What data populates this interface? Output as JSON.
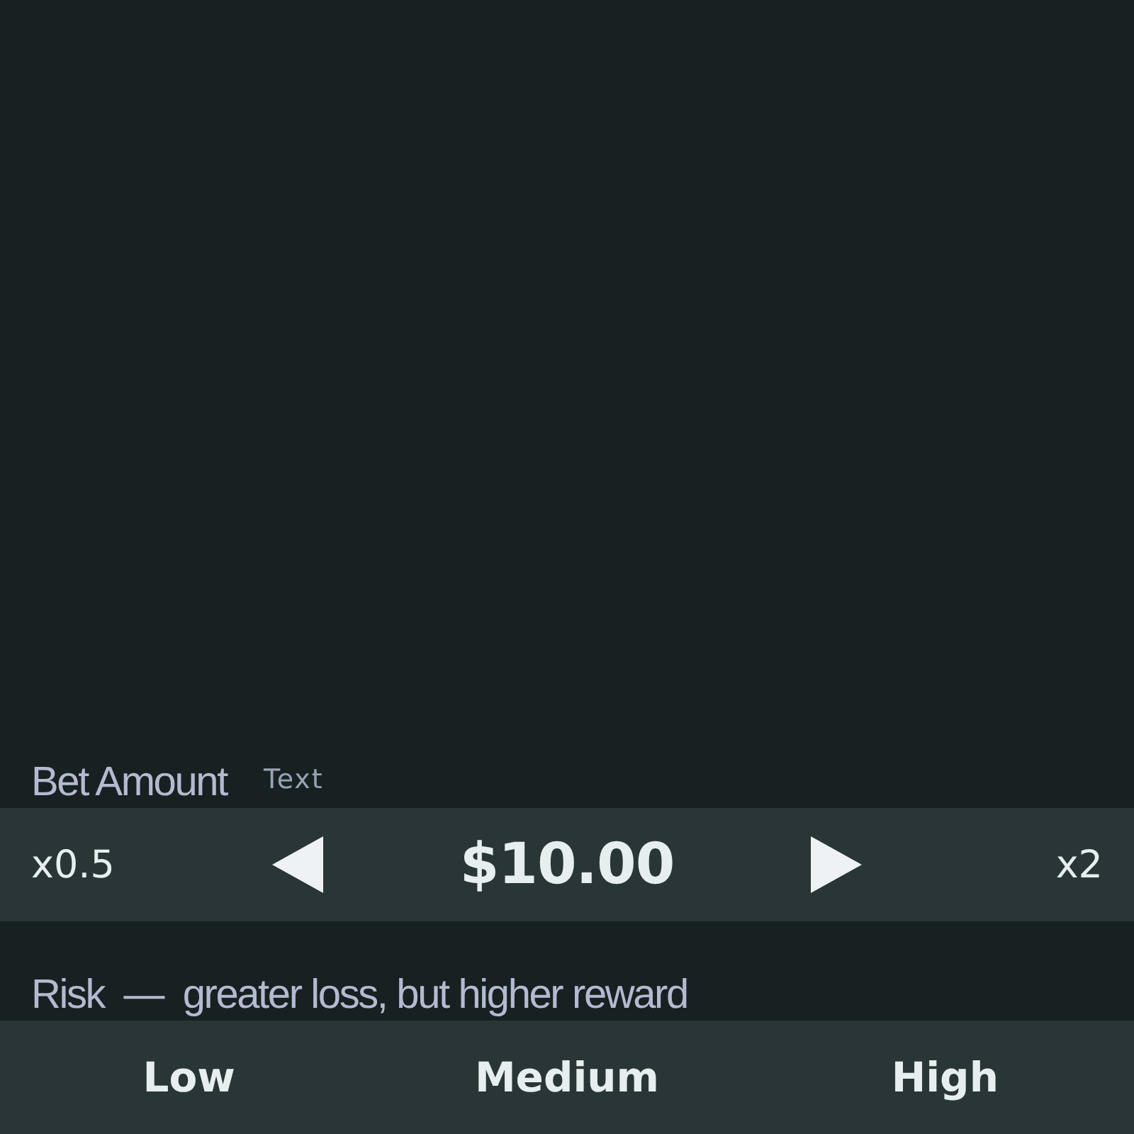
{
  "bet": {
    "label": "Bet Amount",
    "hint": "Text",
    "halve": "x0.5",
    "value": "$10.00",
    "double": "x2"
  },
  "risk": {
    "label": "Risk  —  greater loss, but higher reward",
    "options": [
      {
        "label": "Low"
      },
      {
        "label": "Medium"
      },
      {
        "label": "High"
      }
    ]
  }
}
